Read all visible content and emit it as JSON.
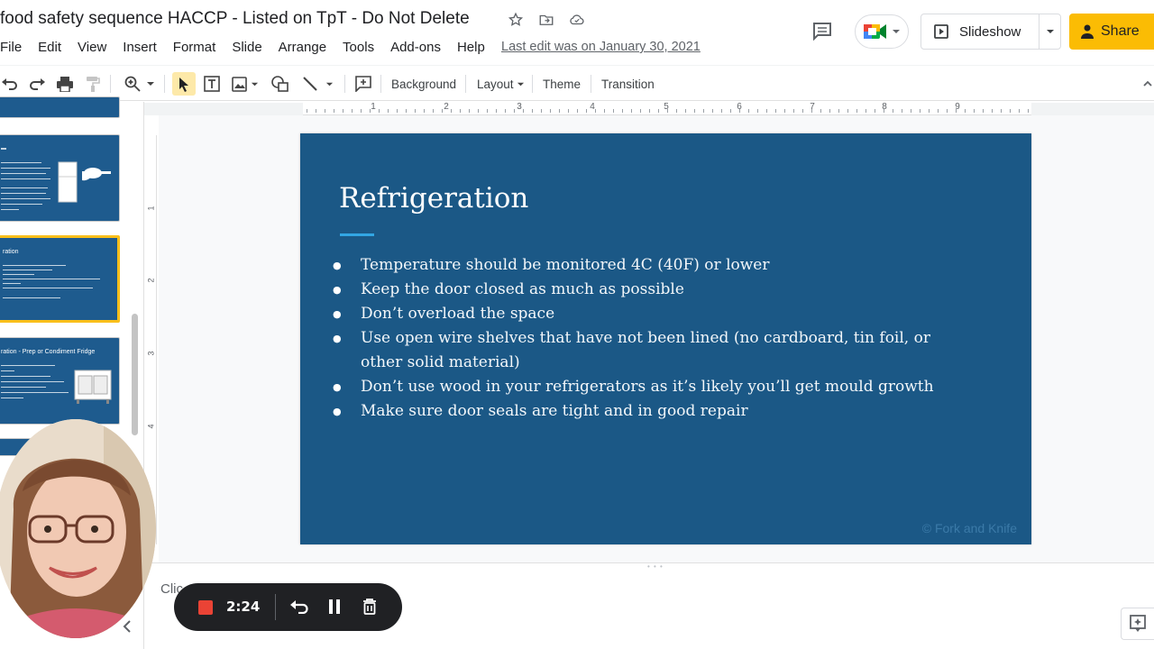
{
  "doc": {
    "title": "food safety sequence HACCP - Listed on TpT - Do Not Delete",
    "last_edit": "Last edit was on January 30, 2021"
  },
  "menu": [
    "File",
    "Edit",
    "View",
    "Insert",
    "Format",
    "Slide",
    "Arrange",
    "Tools",
    "Add-ons",
    "Help"
  ],
  "header": {
    "slideshow_label": "Slideshow",
    "share_label": "Share"
  },
  "toolbar": {
    "background": "Background",
    "layout": "Layout",
    "theme": "Theme",
    "transition": "Transition"
  },
  "ruler": {
    "h_labels": [
      "1",
      "2",
      "3",
      "4",
      "5",
      "6",
      "7",
      "8",
      "9"
    ],
    "v_labels": [
      "1",
      "2",
      "3",
      "4"
    ]
  },
  "slide": {
    "title": "Refrigeration",
    "bullets": [
      "Temperature should be monitored 4C (40F) or lower",
      "Keep the door closed as much as possible",
      "Don’t overload the space",
      "Use open wire shelves that have not been lined (no cardboard, tin foil, or other solid material)",
      "Don’t use wood in your refrigerators as it’s likely you’ll get mould growth",
      "Make sure door seals are tight and in good repair"
    ],
    "footer": "© Fork and Knife"
  },
  "filmstrip": {
    "thumb3_title": "ration",
    "thumb4_title": "ration - Prep or Condiment Fridge",
    "selected_index": 3
  },
  "notes": {
    "placeholder": "Clic"
  },
  "recorder": {
    "time": "2:24"
  },
  "colors": {
    "slide_bg": "#1b5886",
    "accent": "#32a6e4",
    "share": "#fbbc04",
    "selection": "#f9bf1b",
    "record": "#ea4335"
  }
}
